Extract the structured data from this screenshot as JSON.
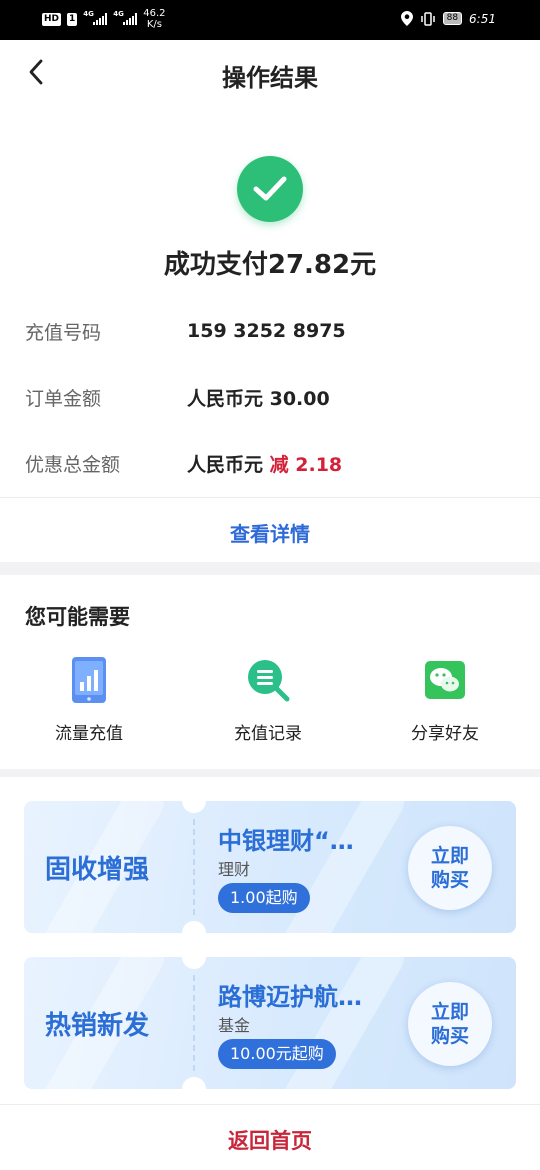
{
  "status_bar": {
    "hd_badge": "HD",
    "sim_badge": "1",
    "net1": "4G",
    "net2": "4G",
    "speed_value": "46.2",
    "speed_unit": "K/s",
    "battery": "88",
    "time": "6:51"
  },
  "header": {
    "title": "操作结果"
  },
  "result": {
    "icon": "check-circle-icon",
    "message": "成功支付27.82元",
    "rows": [
      {
        "label": "充值号码",
        "value": "159 3252 8975"
      },
      {
        "label": "订单金额",
        "value": "人民币元 30.00"
      },
      {
        "label": "优惠总金额",
        "value_prefix": "人民币元",
        "value_red": "减 2.18"
      }
    ],
    "detail_link": "查看详情"
  },
  "needs": {
    "title": "您可能需要",
    "items": [
      {
        "icon": "data-chart-phone-icon",
        "label": "流量充值"
      },
      {
        "icon": "search-record-icon",
        "label": "充值记录"
      },
      {
        "icon": "wechat-icon",
        "label": "分享好友"
      }
    ]
  },
  "products": [
    {
      "category": "固收增强",
      "name": "中银理财“…",
      "type": "理财",
      "tag": "1.00起购",
      "buy_line1": "立即",
      "buy_line2": "购买"
    },
    {
      "category": "热销新发",
      "name": "路博迈护航…",
      "type": "基金",
      "tag": "10.00元起购",
      "buy_line1": "立即",
      "buy_line2": "购买"
    }
  ],
  "bottom": {
    "home_label": "返回首页"
  },
  "colors": {
    "success": "#2dbf78",
    "link_blue": "#2e6bd9",
    "discount_red": "#d4213a",
    "home_red": "#c8263a"
  }
}
